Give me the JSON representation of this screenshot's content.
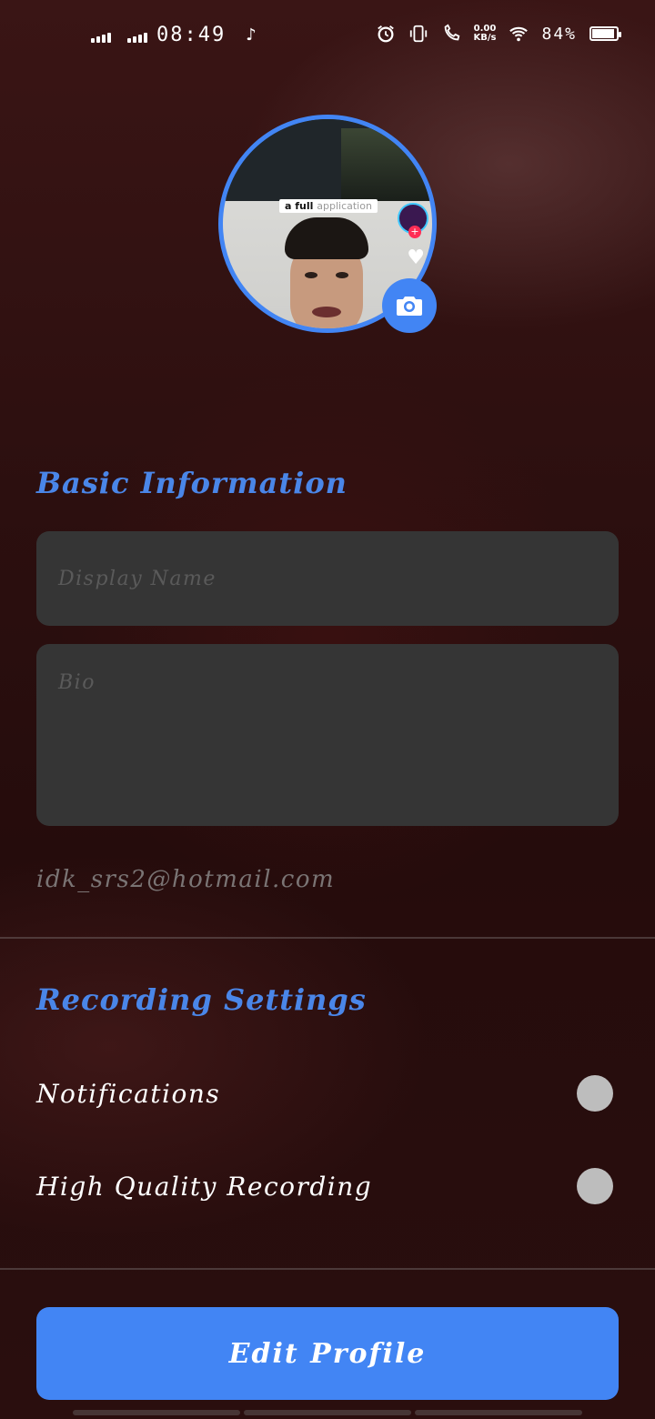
{
  "status_bar": {
    "time": "08:49",
    "net_speed_value": "0.00",
    "net_speed_unit": "KB/s",
    "battery_percent": "84%",
    "battery_level": 0.84
  },
  "avatar": {
    "caption_bold": "a full",
    "caption_faded": "application"
  },
  "basic_info": {
    "title": "Basic Information",
    "display_name_placeholder": "Display Name",
    "display_name_value": "",
    "bio_placeholder": "Bio",
    "bio_value": "",
    "email": "idk_srs2@hotmail.com"
  },
  "recording": {
    "title": "Recording Settings",
    "notifications_label": "Notifications",
    "notifications_on": false,
    "hq_label": "High Quality Recording",
    "hq_on": false
  },
  "actions": {
    "edit_profile_label": "Edit Profile"
  },
  "colors": {
    "accent": "#4285f4",
    "input_bg": "#353535",
    "toggle_off": "#bdbdbd"
  }
}
